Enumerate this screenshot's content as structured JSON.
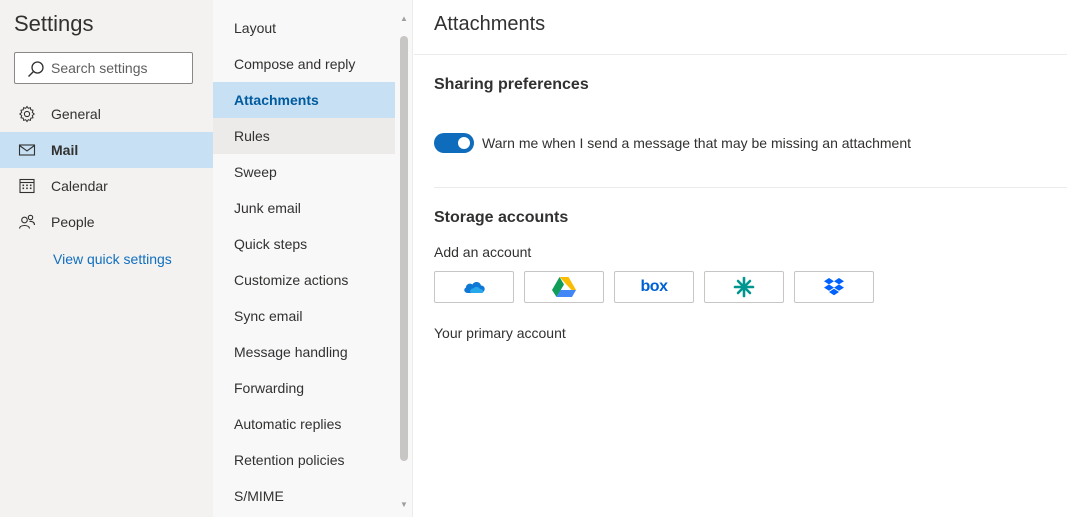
{
  "app": {
    "title": "Settings"
  },
  "search": {
    "placeholder": "Search settings",
    "icon": "search-icon"
  },
  "nav": {
    "items": [
      {
        "label": "General",
        "icon": "gear-icon",
        "active": false
      },
      {
        "label": "Mail",
        "icon": "mail-icon",
        "active": true
      },
      {
        "label": "Calendar",
        "icon": "calendar-icon",
        "active": false
      },
      {
        "label": "People",
        "icon": "people-icon",
        "active": false
      }
    ],
    "quick_settings": "View quick settings"
  },
  "mail_nav": {
    "items": [
      {
        "label": "Layout"
      },
      {
        "label": "Compose and reply"
      },
      {
        "label": "Attachments",
        "active": true
      },
      {
        "label": "Rules",
        "hovered": true
      },
      {
        "label": "Sweep"
      },
      {
        "label": "Junk email"
      },
      {
        "label": "Quick steps"
      },
      {
        "label": "Customize actions"
      },
      {
        "label": "Sync email"
      },
      {
        "label": "Message handling"
      },
      {
        "label": "Forwarding"
      },
      {
        "label": "Automatic replies"
      },
      {
        "label": "Retention policies"
      },
      {
        "label": "S/MIME"
      }
    ]
  },
  "content": {
    "title": "Attachments",
    "sharing": {
      "heading": "Sharing preferences",
      "toggle_on": true,
      "toggle_label": "Warn me when I send a message that may be missing an attachment"
    },
    "storage": {
      "heading": "Storage accounts",
      "add_label": "Add an account",
      "providers": [
        {
          "icon": "onedrive-icon"
        },
        {
          "icon": "google-drive-icon"
        },
        {
          "icon": "box-icon",
          "text": "box"
        },
        {
          "icon": "egnyte-icon"
        },
        {
          "icon": "dropbox-icon"
        }
      ],
      "primary_label": "Your primary account"
    }
  },
  "colors": {
    "accent": "#0f6cbd",
    "selected_bg": "#c7e0f4",
    "link": "#106ebe"
  }
}
